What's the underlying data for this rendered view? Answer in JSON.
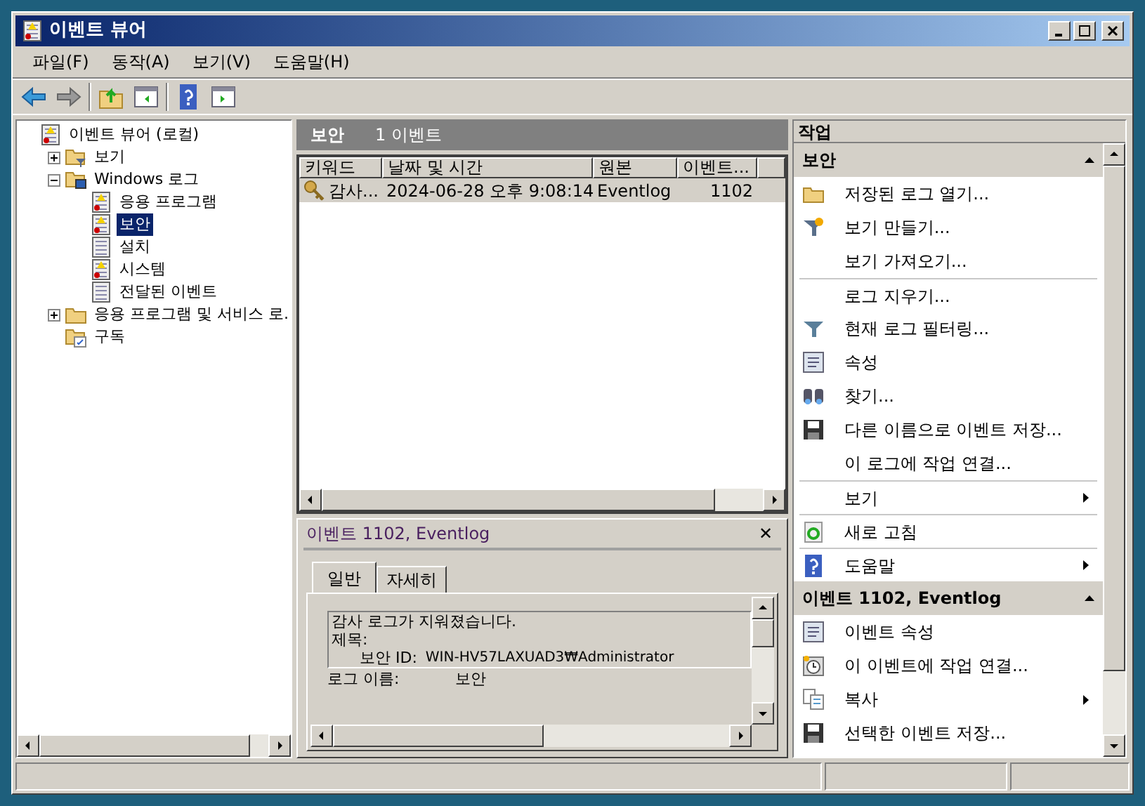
{
  "window": {
    "title": "이벤트 뷰어"
  },
  "menu": [
    "파일(F)",
    "동작(A)",
    "보기(V)",
    "도움말(H)"
  ],
  "toolbar": [
    {
      "kind": "back"
    },
    {
      "kind": "forward"
    },
    {
      "kind": "sep"
    },
    {
      "kind": "up"
    },
    {
      "kind": "pane-left"
    },
    {
      "kind": "sep"
    },
    {
      "kind": "help"
    },
    {
      "kind": "pane-right"
    }
  ],
  "tree": [
    {
      "label": "이벤트 뷰어 (로컬)",
      "kind": "log",
      "selected": false,
      "expanded": true,
      "children": [
        {
          "label": "보기",
          "kind": "folder-filter",
          "selected": false,
          "expanded": false
        },
        {
          "label": "Windows 로그",
          "kind": "folder-win",
          "selected": false,
          "expanded": true,
          "children": [
            {
              "label": "응용 프로그램",
              "kind": "log",
              "selected": false
            },
            {
              "label": "보안",
              "kind": "log",
              "selected": true
            },
            {
              "label": "설치",
              "kind": "sheet",
              "selected": false
            },
            {
              "label": "시스템",
              "kind": "log",
              "selected": false
            },
            {
              "label": "전달된 이벤트",
              "kind": "sheet",
              "selected": false
            }
          ]
        },
        {
          "label": "응용 프로그램 및 서비스 로.",
          "kind": "folder",
          "selected": false,
          "expanded": false
        },
        {
          "label": "구독",
          "kind": "folder-sub",
          "selected": false
        }
      ]
    }
  ],
  "log_header": {
    "title": "보안",
    "count": "1 이벤트"
  },
  "table": {
    "columns": [
      "키워드",
      "날짜 및 시간",
      "원본",
      "이벤트...",
      ""
    ],
    "rows": [
      {
        "selected": true,
        "cells": [
          "감사...",
          "2024-06-28 오후 9:08:14",
          "Eventlog",
          "1102"
        ]
      }
    ]
  },
  "detail": {
    "title": "이벤트 1102, Eventlog",
    "close": "✕",
    "tabs": [
      {
        "label": "일반",
        "selected": true
      },
      {
        "label": "자세히",
        "selected": false
      }
    ],
    "lines": [
      "감사 로그가 지워졌습니다.",
      "제목:"
    ],
    "field_label": "보안 ID:",
    "field_value": "WIN-HV57LAXUAD3₩Administrator",
    "log_label": "로그 이름:",
    "log_value": "보안"
  },
  "actions": {
    "title": "작업",
    "sections": [
      {
        "title": "보안",
        "items": [
          {
            "label": "저장된 로그 열기...",
            "kind": "folder",
            "separator": false,
            "submenu": false
          },
          {
            "label": "보기 만들기...",
            "kind": "filter-star",
            "separator": false,
            "submenu": false
          },
          {
            "label": "보기 가져오기...",
            "kind": "none",
            "separator": false,
            "submenu": false
          },
          {
            "label": "로그 지우기...",
            "kind": "none",
            "separator": true,
            "submenu": false
          },
          {
            "label": "현재 로그 필터링...",
            "kind": "filter",
            "separator": false,
            "submenu": false
          },
          {
            "label": "속성",
            "kind": "props",
            "separator": false,
            "submenu": false
          },
          {
            "label": "찾기...",
            "kind": "binoculars",
            "separator": false,
            "submenu": false
          },
          {
            "label": "다른 이름으로 이벤트 저장...",
            "kind": "disk",
            "separator": false,
            "submenu": false
          },
          {
            "label": "이 로그에 작업 연결...",
            "kind": "none",
            "separator": false,
            "submenu": false
          },
          {
            "label": "보기",
            "kind": "none",
            "separator": true,
            "submenu": true
          },
          {
            "label": "새로 고침",
            "kind": "refresh",
            "separator": true,
            "submenu": false
          },
          {
            "label": "도움말",
            "kind": "help",
            "separator": true,
            "submenu": true
          }
        ]
      },
      {
        "title": "이벤트 1102, Eventlog",
        "items": [
          {
            "label": "이벤트 속성",
            "kind": "props",
            "separator": false,
            "submenu": false
          },
          {
            "label": "이 이벤트에 작업 연결...",
            "kind": "clock",
            "separator": false,
            "submenu": false
          },
          {
            "label": "복사",
            "kind": "copy",
            "separator": false,
            "submenu": true
          },
          {
            "label": "선택한 이벤트 저장...",
            "kind": "disk",
            "separator": false,
            "submenu": false
          }
        ]
      }
    ]
  }
}
